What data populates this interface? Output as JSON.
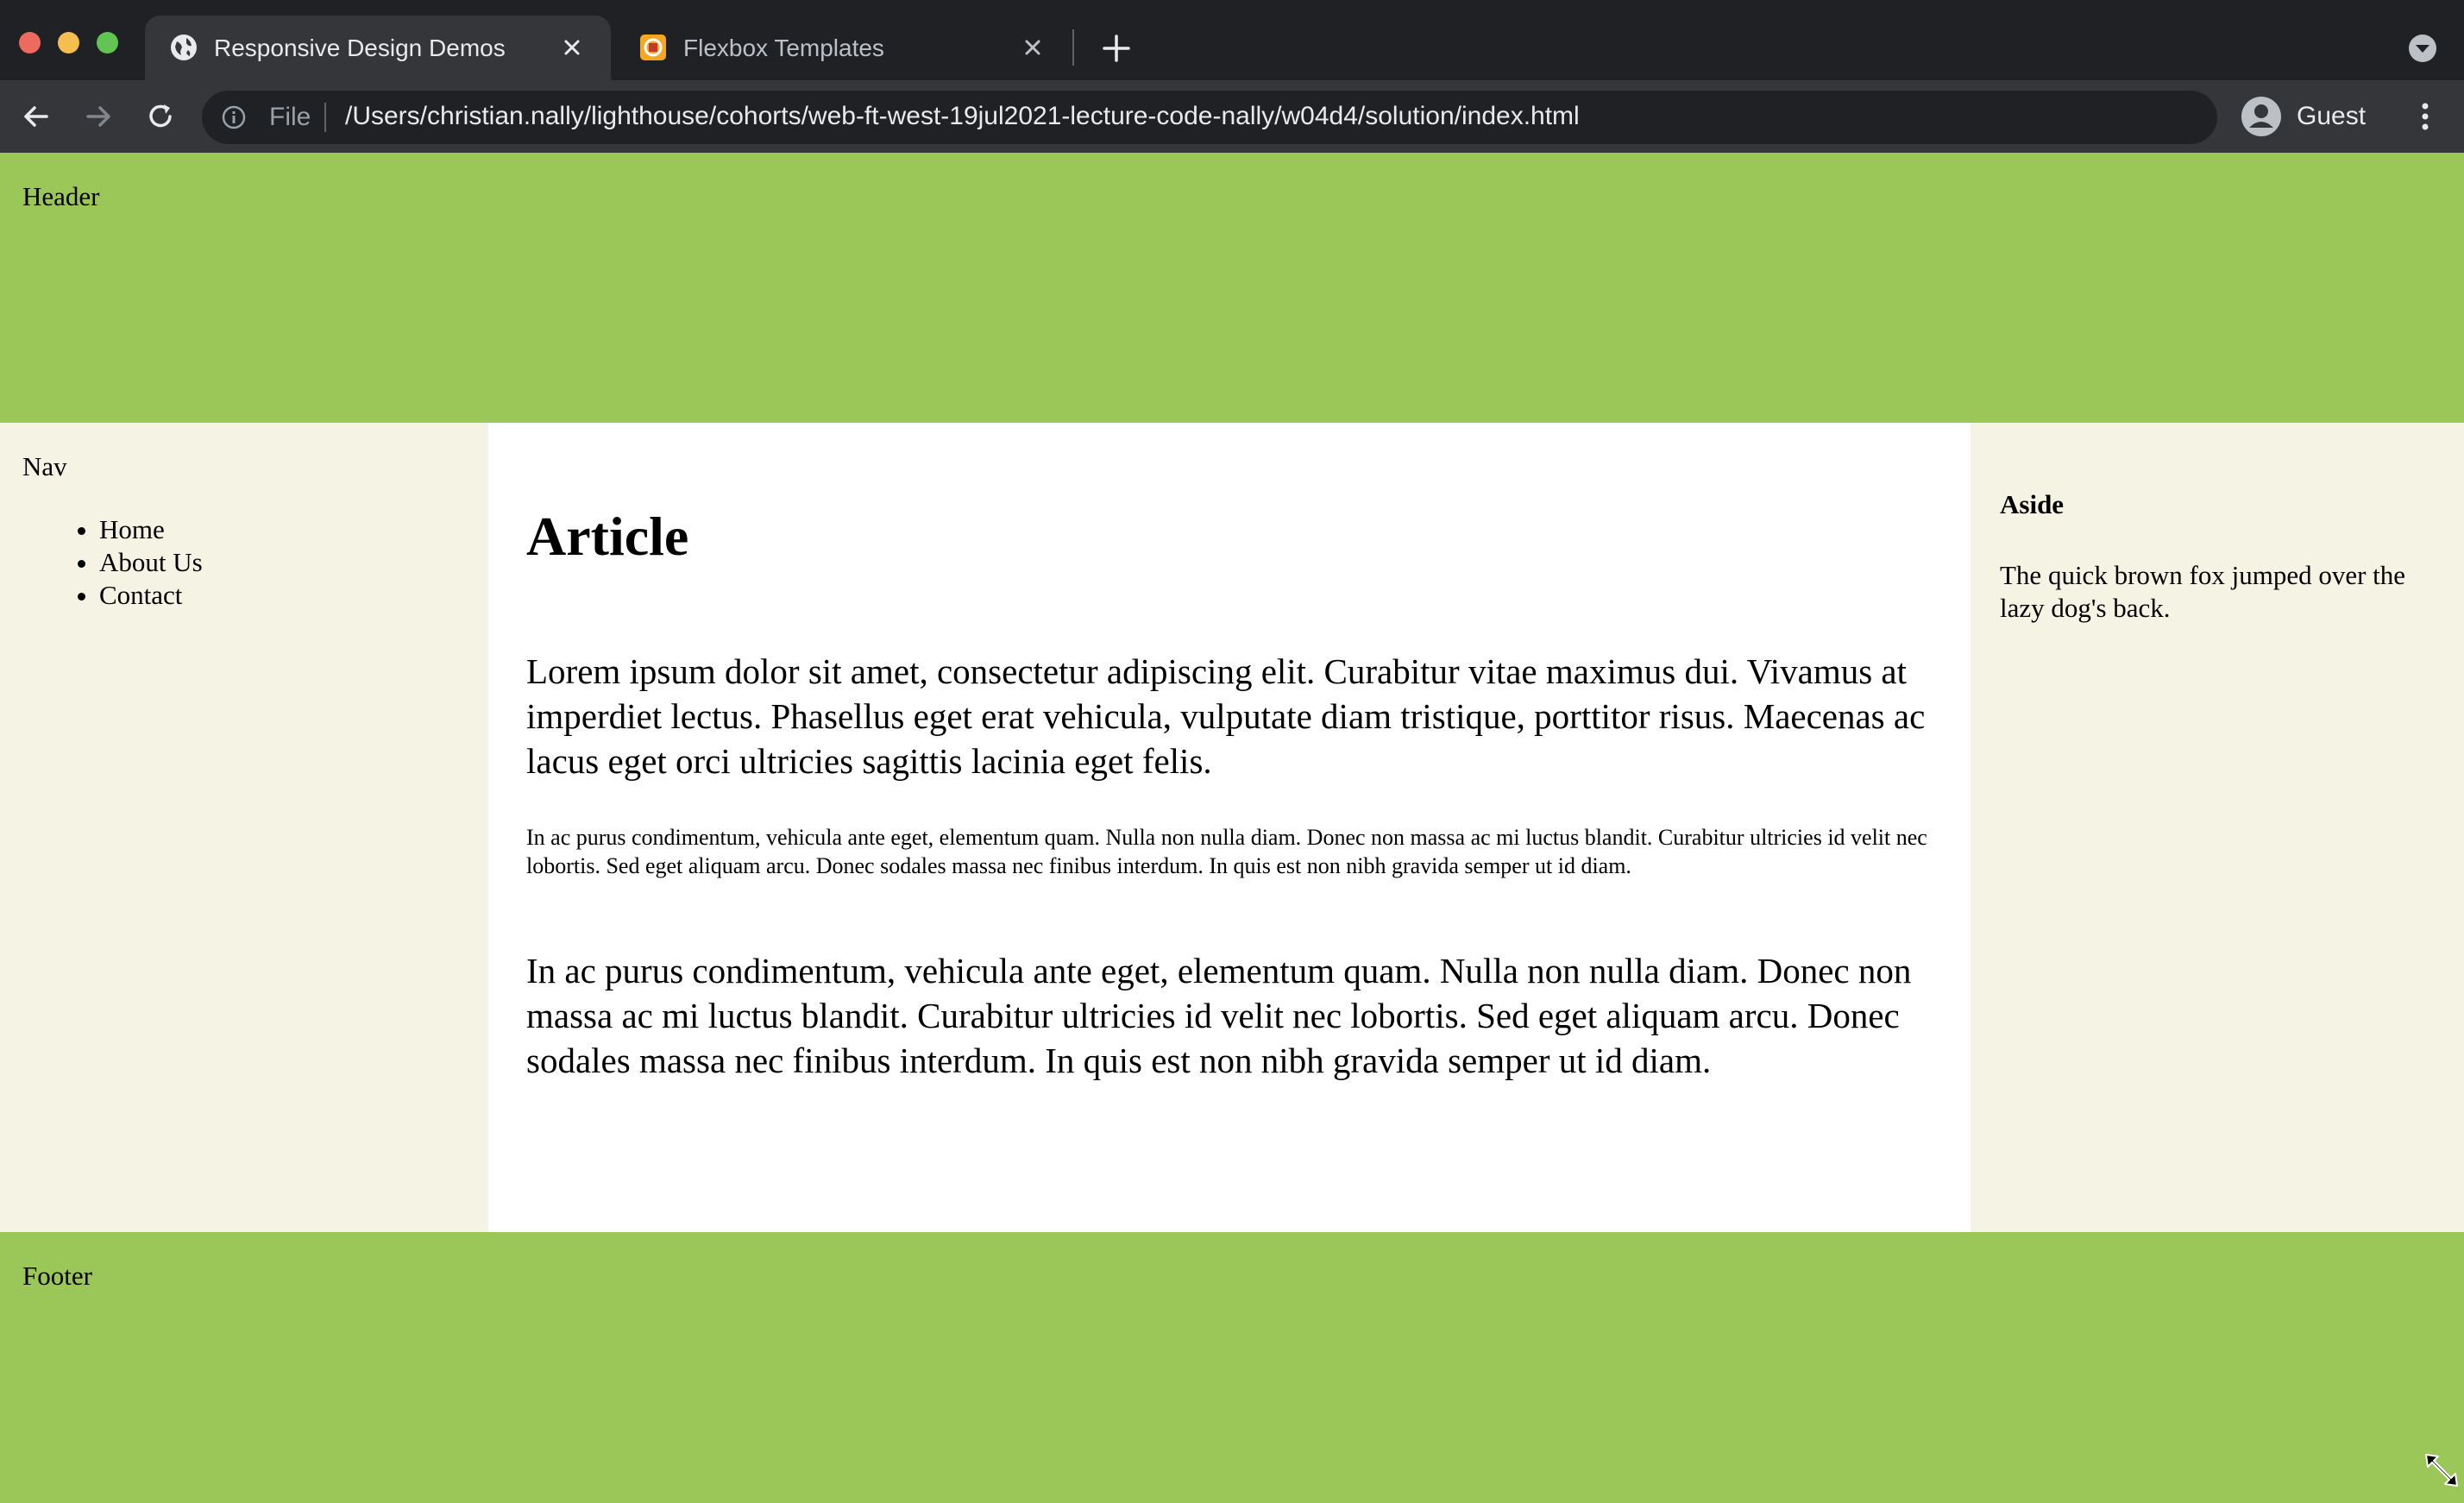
{
  "browser": {
    "tabs": [
      {
        "title": "Responsive Design Demos",
        "active": true,
        "favicon": "globe-icon"
      },
      {
        "title": "Flexbox Templates",
        "active": false,
        "favicon": "site-favicon-icon"
      }
    ],
    "address_bar": {
      "scheme_label": "File",
      "url": "/Users/christian.nally/lighthouse/cohorts/web-ft-west-19jul2021-lecture-code-nally/w04d4/solution/index.html"
    },
    "profile_label": "Guest"
  },
  "page": {
    "header_label": "Header",
    "nav": {
      "label": "Nav",
      "items": [
        "Home",
        "About Us",
        "Contact"
      ]
    },
    "article": {
      "heading": "Article",
      "paragraph_1": "Lorem ipsum dolor sit amet, consectetur adipiscing elit. Curabitur vitae maximus dui. Vivamus at imperdiet lectus. Phasellus eget erat vehicula, vulputate diam tristique, porttitor risus. Maecenas ac lacus eget orci ultricies sagittis lacinia eget felis.",
      "paragraph_2": "In ac purus condimentum, vehicula ante eget, elementum quam. Nulla non nulla diam. Donec non massa ac mi luctus blandit. Curabitur ultricies id velit nec lobortis. Sed eget aliquam arcu. Donec sodales massa nec finibus interdum. In quis est non nibh gravida semper ut id diam.",
      "paragraph_3": "In ac purus condimentum, vehicula ante eget, elementum quam. Nulla non nulla diam. Donec non massa ac mi luctus blandit. Curabitur ultricies id velit nec lobortis. Sed eget aliquam arcu. Donec sodales massa nec finibus interdum. In quis est non nibh gravida semper ut id diam."
    },
    "aside": {
      "heading": "Aside",
      "text": "The quick brown fox jumped over the lazy dog's back."
    },
    "footer_label": "Footer"
  },
  "colors": {
    "header_footer_bg": "#9bc658",
    "sidebar_bg": "#f5f3e4",
    "main_bg": "#ffffff",
    "chrome_dark": "#202124",
    "chrome_toolbar": "#35363a"
  }
}
